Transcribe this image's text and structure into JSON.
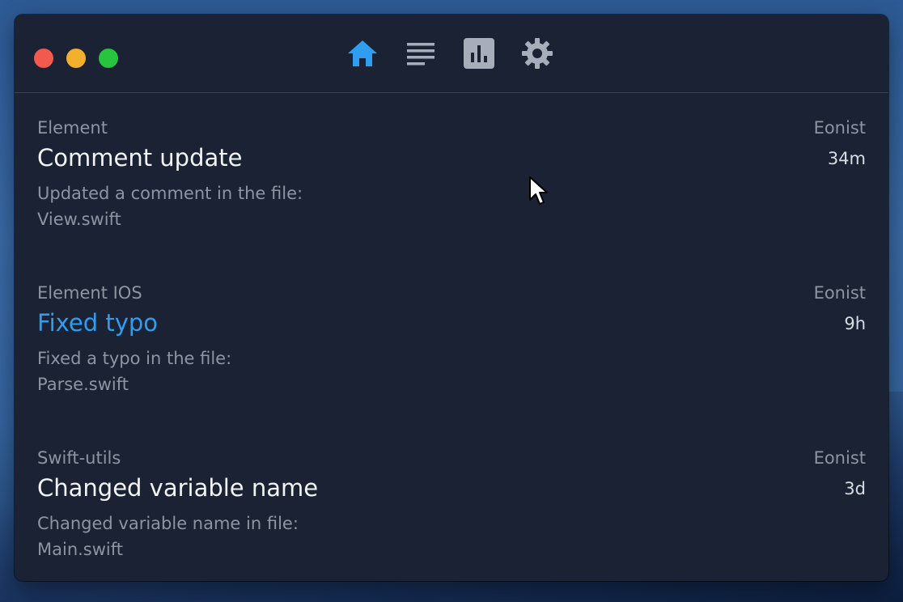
{
  "window": {
    "toolbar": {
      "icons": [
        "home-icon",
        "list-icon",
        "chart-icon",
        "gear-icon"
      ],
      "active": "home-icon",
      "accent": "#2f9ef0",
      "inactive_color": "#a7aeb9"
    }
  },
  "feed": {
    "items": [
      {
        "repo": "Element",
        "author": "Eonist",
        "title": "Comment update",
        "time": "34m",
        "desc": "Updated a comment in the file: View.swift"
      },
      {
        "repo": "Element IOS",
        "author": "Eonist",
        "title": "Fixed typo",
        "time": "9h",
        "desc": "Fixed a typo in the file: Parse.swift"
      },
      {
        "repo": "Swift-utils",
        "author": "Eonist",
        "title": "Changed variable name",
        "time": "3d",
        "desc": "Changed variable name in file: Main.swift"
      }
    ]
  }
}
